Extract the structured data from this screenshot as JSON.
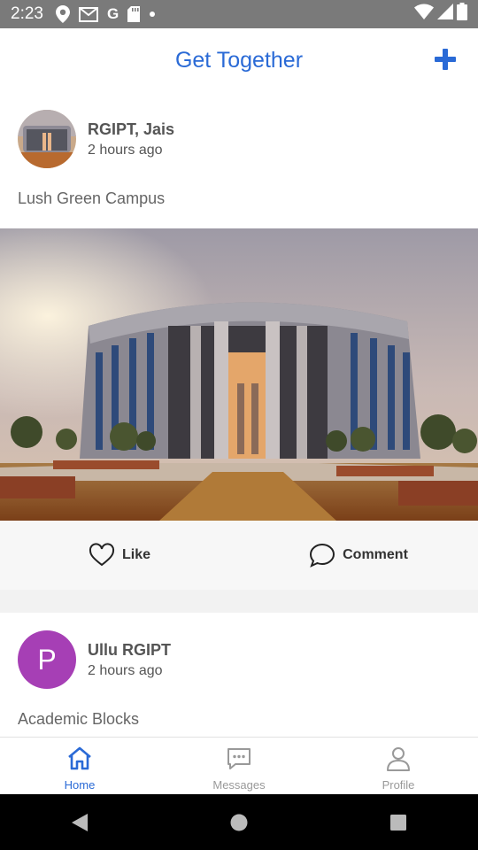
{
  "status_bar": {
    "time": "2:23",
    "icons": [
      "location-icon",
      "gmail-icon",
      "google-icon",
      "sd-card-icon",
      "dot-icon",
      "wifi-icon",
      "signal-icon",
      "battery-icon"
    ]
  },
  "header": {
    "title": "Get Together",
    "add_icon": "plus-icon",
    "accent_color": "#2a6ad6"
  },
  "posts": [
    {
      "author": "RGIPT, Jais",
      "time": "2 hours ago",
      "caption": "Lush Green Campus",
      "like_label": "Like",
      "comment_label": "Comment"
    },
    {
      "author": "Ullu  RGIPT",
      "avatar_letter": "P",
      "avatar_color": "#a63fb5",
      "time": "2 hours ago",
      "caption": "Academic Blocks"
    }
  ],
  "bottom_nav": {
    "items": [
      {
        "label": "Home",
        "icon": "home-icon",
        "active": true
      },
      {
        "label": "Messages",
        "icon": "messages-icon",
        "active": false
      },
      {
        "label": "Profile",
        "icon": "profile-icon",
        "active": false
      }
    ]
  },
  "system_nav": [
    "back-icon",
    "home-circle-icon",
    "recents-icon"
  ]
}
